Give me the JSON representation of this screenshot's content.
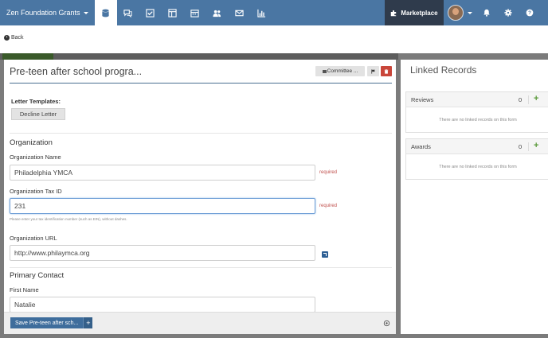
{
  "topnav": {
    "brand": "Zen Foundation Grants",
    "icons": [
      "database-icon",
      "comments-icon",
      "check-square-icon",
      "columns-icon",
      "calendar-icon",
      "users-icon",
      "envelope-icon",
      "bar-chart-icon"
    ],
    "marketplace_label": "Marketplace",
    "right_icons": [
      "bell-icon",
      "gear-icon",
      "help-icon"
    ]
  },
  "backbar": {
    "back_label": "Back"
  },
  "form": {
    "title": "Pre-teen after school progra...",
    "committee_label": "Committee ...",
    "letter_templates_label": "Letter Templates:",
    "decline_letter_label": "Decline Letter",
    "organization_heading": "Organization",
    "org_name_label": "Organization Name",
    "org_name_value": "Philadelphia YMCA",
    "org_name_required": "required",
    "tax_id_label": "Organization Tax ID",
    "tax_id_value": "231",
    "tax_id_required": "required",
    "tax_id_help": "Please enter your tax identification number (such as EIN), without dashes.",
    "url_label": "Organization URL",
    "url_value": "http://www.philaymca.org",
    "primary_contact_heading": "Primary Contact",
    "first_name_label": "First Name",
    "first_name_value": "Natalie",
    "save_label": "Save Pre-teen after sch...",
    "save_plus": "+"
  },
  "linked_records": {
    "title": "Linked Records",
    "boxes": [
      {
        "name": "Reviews",
        "count": "0",
        "empty": "There are no linked records on this form"
      },
      {
        "name": "Awards",
        "count": "0",
        "empty": "There are no linked records on this form"
      }
    ],
    "plus": "+"
  },
  "colors": {
    "nav_bg": "#4a76a3",
    "marketplace_bg": "#2f3b4c",
    "required": "#c0504d",
    "save_bg": "#3e6d9c",
    "danger": "#c9463a"
  }
}
